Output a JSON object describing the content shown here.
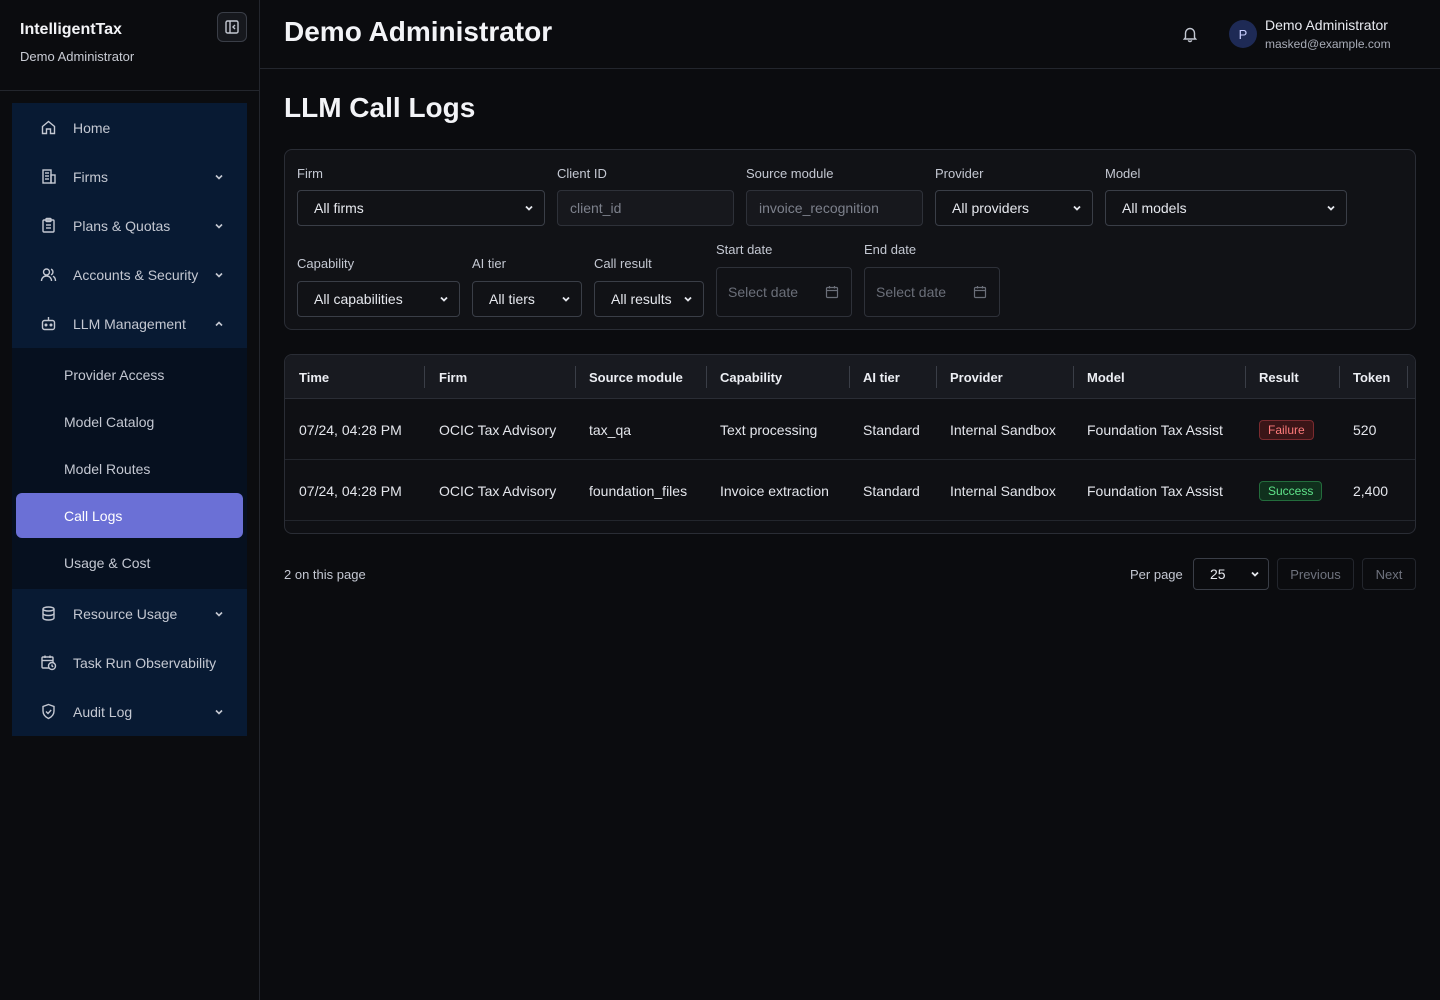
{
  "brand": {
    "name": "IntelligentTax",
    "subtitle": "Demo Administrator"
  },
  "sidebar": {
    "items": [
      {
        "label": "Home",
        "icon": "home-icon"
      },
      {
        "label": "Firms",
        "icon": "building-icon",
        "expandable": true
      },
      {
        "label": "Plans & Quotas",
        "icon": "clipboard-icon",
        "expandable": true
      },
      {
        "label": "Accounts & Security",
        "icon": "users-icon",
        "expandable": true
      },
      {
        "label": "LLM Management",
        "icon": "bot-icon",
        "expanded": true
      }
    ],
    "llm_sub": [
      "Provider Access",
      "Model Catalog",
      "Model Routes",
      "Call Logs",
      "Usage & Cost"
    ],
    "active_sub": "Call Logs",
    "lower_items": [
      {
        "label": "Resource Usage",
        "icon": "database-icon",
        "expandable": true
      },
      {
        "label": "Task Run Observability",
        "icon": "calendar-clock-icon"
      },
      {
        "label": "Audit Log",
        "icon": "shield-check-icon",
        "expandable": true
      }
    ]
  },
  "header": {
    "title": "Demo Administrator",
    "avatar_initial": "P",
    "user_name": "Demo Administrator",
    "user_email": "masked@example.com"
  },
  "page_title": "LLM Call Logs",
  "filters": {
    "firm": {
      "label": "Firm",
      "value": "All firms"
    },
    "client_id": {
      "label": "Client ID",
      "placeholder": "client_id"
    },
    "source_module": {
      "label": "Source module",
      "placeholder": "invoice_recognition"
    },
    "provider": {
      "label": "Provider",
      "value": "All providers"
    },
    "model": {
      "label": "Model",
      "value": "All models"
    },
    "capability": {
      "label": "Capability",
      "value": "All capabilities"
    },
    "ai_tier": {
      "label": "AI tier",
      "value": "All tiers"
    },
    "call_result": {
      "label": "Call result",
      "value": "All results"
    },
    "start_date": {
      "label": "Start date",
      "placeholder": "Select date"
    },
    "end_date": {
      "label": "End date",
      "placeholder": "Select date"
    }
  },
  "table": {
    "columns": [
      "Time",
      "Firm",
      "Source module",
      "Capability",
      "AI tier",
      "Provider",
      "Model",
      "Result",
      "Token"
    ],
    "rows": [
      {
        "time": "07/24, 04:28 PM",
        "firm": "OCIC Tax Advisory",
        "source": "tax_qa",
        "capability": "Text processing",
        "tier": "Standard",
        "provider": "Internal Sandbox",
        "model": "Foundation Tax Assist",
        "result": "Failure",
        "token": "520"
      },
      {
        "time": "07/24, 04:28 PM",
        "firm": "OCIC Tax Advisory",
        "source": "foundation_files",
        "capability": "Invoice extraction",
        "tier": "Standard",
        "provider": "Internal Sandbox",
        "model": "Foundation Tax Assist",
        "result": "Success",
        "token": "2,400"
      }
    ]
  },
  "footer": {
    "count_text": "2 on this page",
    "per_page_label": "Per page",
    "per_page_value": "25",
    "previous": "Previous",
    "next": "Next"
  },
  "colors": {
    "accent": "#6b70d6",
    "failure": "#ff7b7b",
    "success": "#5fe38a",
    "nav_bg": "#081a33"
  }
}
